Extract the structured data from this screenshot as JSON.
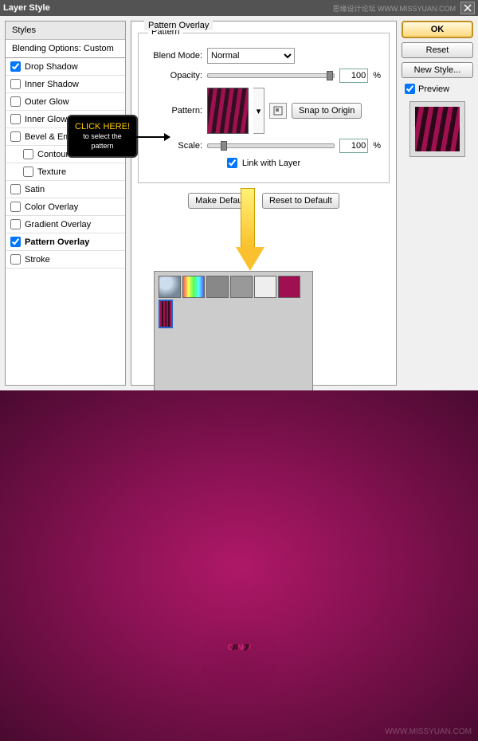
{
  "titlebar": {
    "title": "Layer Style",
    "watermark": "思缘设计论坛 WWW.MISSYUAN.COM"
  },
  "stylesPanel": {
    "header": "Styles",
    "blending": "Blending Options: Custom",
    "items": [
      {
        "label": "Drop Shadow",
        "checked": true
      },
      {
        "label": "Inner Shadow",
        "checked": false
      },
      {
        "label": "Outer Glow",
        "checked": false
      },
      {
        "label": "Inner Glow",
        "checked": false
      },
      {
        "label": "Bevel & Emboss",
        "checked": false
      },
      {
        "label": "Contour",
        "checked": false,
        "indent": true
      },
      {
        "label": "Texture",
        "checked": false,
        "indent": true
      },
      {
        "label": "Satin",
        "checked": false
      },
      {
        "label": "Color Overlay",
        "checked": false
      },
      {
        "label": "Gradient Overlay",
        "checked": false
      },
      {
        "label": "Pattern Overlay",
        "checked": true,
        "active": true
      },
      {
        "label": "Stroke",
        "checked": false
      }
    ]
  },
  "center": {
    "sectionTitle": "Pattern Overlay",
    "fieldsetTitle": "Pattern",
    "blendModeLabel": "Blend Mode:",
    "blendModeValue": "Normal",
    "opacityLabel": "Opacity:",
    "opacityValue": "100",
    "patternLabel": "Pattern:",
    "snapBtn": "Snap to Origin",
    "scaleLabel": "Scale:",
    "scaleValue": "100",
    "linkLabel": "Link with Layer",
    "makeDefault": "Make Default",
    "resetDefault": "Reset to Default",
    "percent": "%"
  },
  "tooltip": {
    "line1": "CLICK HERE!",
    "line2": "to select the",
    "line3": "pattern"
  },
  "right": {
    "ok": "OK",
    "reset": "Reset",
    "newStyle": "New Style...",
    "preview": "Preview"
  },
  "result": {
    "text": "CANDY",
    "watermark": "WWW.MISSYUAN.COM"
  }
}
